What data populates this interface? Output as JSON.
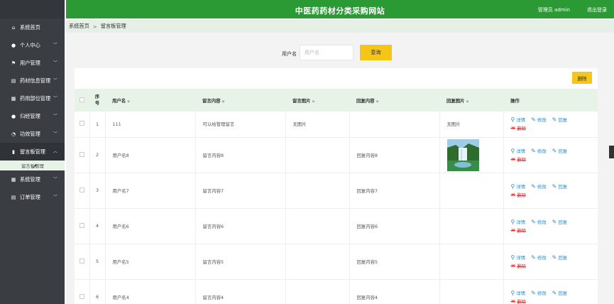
{
  "header": {
    "title": "中医药药材分类采购网站",
    "user": "管理员 admin",
    "logout": "退出登录"
  },
  "sidebar": {
    "items": [
      {
        "label": "系统首页",
        "icon": "home-icon",
        "glyph": "⌂",
        "chevron": false
      },
      {
        "label": "个人中心",
        "icon": "person-icon",
        "glyph": "●",
        "chevron": true
      },
      {
        "label": "用户管理",
        "icon": "flag-icon",
        "glyph": "⚑",
        "chevron": true
      },
      {
        "label": "药材信息管理",
        "icon": "list-icon",
        "glyph": "▤",
        "chevron": true
      },
      {
        "label": "药用部位管理",
        "icon": "grid-icon",
        "glyph": "▦",
        "chevron": true
      },
      {
        "label": "归经管理",
        "icon": "person-icon",
        "glyph": "●",
        "chevron": true
      },
      {
        "label": "功效管理",
        "icon": "clock-icon",
        "glyph": "◔",
        "chevron": true
      },
      {
        "label": "留言板管理",
        "icon": "bar-chart-icon",
        "glyph": "▮",
        "chevron": true,
        "expanded": true
      },
      {
        "label": "系统管理",
        "icon": "grid-icon",
        "glyph": "▦",
        "chevron": true
      },
      {
        "label": "订单管理",
        "icon": "list-icon",
        "glyph": "▤",
        "chevron": true
      }
    ],
    "sub_item": "留言板管理"
  },
  "breadcrumb": {
    "home": "系统首页",
    "separator": ">",
    "current": "留言板管理"
  },
  "search": {
    "label": "用户名",
    "placeholder": "用户名",
    "button": "查询"
  },
  "actions": {
    "delete": "删除"
  },
  "table": {
    "columns": [
      "序号",
      "用户名",
      "留言内容",
      "留言图片",
      "回复内容",
      "回复图片",
      "操作"
    ],
    "index_col_line1": "序",
    "index_col_line2": "号",
    "ops": {
      "detail": "详情",
      "edit": "修改",
      "reply": "回复",
      "delete": "删除"
    },
    "rows": [
      {
        "no": "1",
        "username": "111",
        "message": "可以给管理留言",
        "msg_image": "无图片",
        "reply": "",
        "reply_image": "无图片",
        "has_image": false
      },
      {
        "no": "2",
        "username": "用户名8",
        "message": "留言内容8",
        "msg_image": "",
        "reply": "回复内容8",
        "reply_image": "",
        "has_image": true
      },
      {
        "no": "3",
        "username": "用户名7",
        "message": "留言内容7",
        "msg_image": "",
        "reply": "回复内容7",
        "reply_image": "",
        "has_image": false
      },
      {
        "no": "4",
        "username": "用户名6",
        "message": "留言内容6",
        "msg_image": "",
        "reply": "回复内容6",
        "reply_image": "",
        "has_image": false
      },
      {
        "no": "5",
        "username": "用户名5",
        "message": "留言内容5",
        "msg_image": "",
        "reply": "回复内容5",
        "reply_image": "",
        "has_image": false
      },
      {
        "no": "6",
        "username": "用户名4",
        "message": "留言内容4",
        "msg_image": "",
        "reply": "回复内容4",
        "reply_image": "",
        "has_image": false
      }
    ]
  },
  "colors": {
    "header": "#2b9a34",
    "sidebar": "#3a3d41",
    "accent_button": "#f5c518",
    "link": "#2d8cc4",
    "danger": "#e22222"
  }
}
